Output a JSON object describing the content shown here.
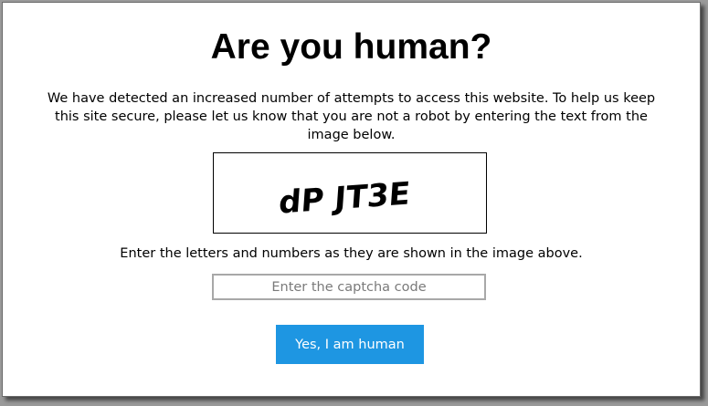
{
  "page": {
    "title": "Are you human?",
    "description": "We have detected an increased number of attempts to access this website. To help us keep this site secure, please let us know that you are not a robot by entering the text from the image below.",
    "instruction": "Enter the letters and numbers as they are shown in the image above."
  },
  "captcha": {
    "image_text": "dP JT3E"
  },
  "form": {
    "input_placeholder": "Enter the captcha code",
    "input_value": "",
    "submit_label": "Yes, I am human"
  },
  "colors": {
    "button_background": "#1e96e2",
    "button_text": "#ffffff",
    "input_border": "#a8a8a8"
  }
}
